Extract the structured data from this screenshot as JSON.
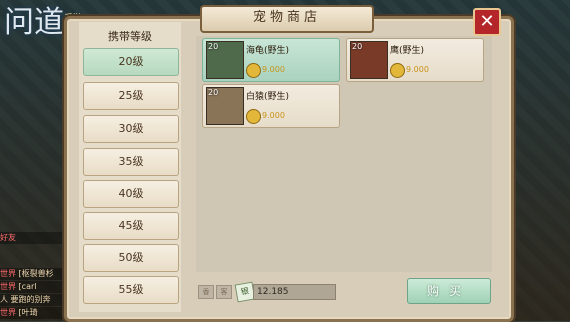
{
  "game": {
    "logo_text": "问道",
    "logo_badge": "手游"
  },
  "chat": [
    {
      "tag": "好友",
      "text": ""
    },
    {
      "tag": "世界",
      "text": "[枢裂兽杉"
    },
    {
      "tag": "世界",
      "text": "[carl"
    },
    {
      "tag": "",
      "text": "人 要跑的别奔"
    },
    {
      "tag": "世界",
      "text": "[叶琦"
    }
  ],
  "dialog": {
    "title": "宠物商店",
    "close_label": "✕"
  },
  "levels": {
    "header": "携带等级",
    "items": [
      "20级",
      "25级",
      "30级",
      "35级",
      "40级",
      "45级",
      "50级",
      "55级"
    ],
    "selected": "20级"
  },
  "pets": [
    {
      "name": "海龟(野生)",
      "level": "20",
      "price": "9.000",
      "selected": true
    },
    {
      "name": "鹰(野生)",
      "level": "20",
      "price": "9.000",
      "selected": false
    },
    {
      "name": "白猿(野生)",
      "level": "20",
      "price": "9.000",
      "selected": false
    }
  ],
  "footer": {
    "tab_a": "香",
    "tab_b": "客",
    "currency_icon": "银",
    "currency_value": "12.185",
    "buy_label": "购买"
  },
  "colors": {
    "selected_green": "#b7d9bf",
    "close_red": "#b5262a",
    "price_gold": "#c8941a"
  }
}
